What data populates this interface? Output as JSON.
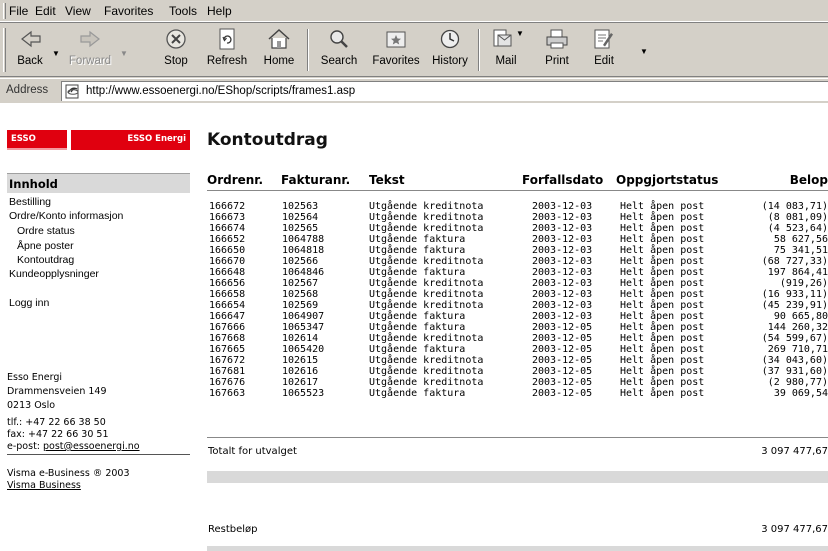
{
  "menu": [
    "File",
    "Edit",
    "View",
    "Favorites",
    "Tools",
    "Help"
  ],
  "toolbar": {
    "back": "Back",
    "forward": "Forward",
    "stop": "Stop",
    "refresh": "Refresh",
    "home": "Home",
    "search": "Search",
    "favorites": "Favorites",
    "history": "History",
    "mail": "Mail",
    "print": "Print",
    "edit": "Edit"
  },
  "address": {
    "label": "Address",
    "url": "http://www.essoenergi.no/EShop/scripts/frames1.asp"
  },
  "logo": {
    "left": "ESSO",
    "right": "ESSO Energi"
  },
  "page_title": "Kontoutdrag",
  "sidebar": {
    "heading": "Innhold",
    "items": [
      {
        "label": "Bestilling"
      },
      {
        "label": "Ordre/Konto informasjon"
      },
      {
        "label": "Ordre status"
      },
      {
        "label": "Åpne poster"
      },
      {
        "label": "Kontoutdrag"
      },
      {
        "label": "Kundeopplysninger"
      },
      {
        "label": "Logg inn"
      }
    ],
    "contact": {
      "company": "Esso Energi",
      "street": "Drammensveien 149",
      "city": "0213 Oslo",
      "phone": "tlf.: +47 22 66 38 50",
      "fax": "fax: +47 22 66 30 51",
      "email_prefix": "e-post: ",
      "email": "post@essoenergi.no"
    },
    "footer": {
      "copyright": "Visma e-Business ® 2003",
      "link": "Visma Business"
    }
  },
  "table": {
    "headers": {
      "ordrenr": "Ordrenr.",
      "fakturanr": "Fakturanr.",
      "tekst": "Tekst",
      "forfallsdato": "Forfallsdato",
      "oppgjortstatus": "Oppgjortstatus",
      "belop": "Belop"
    },
    "rows": [
      {
        "ordrenr": "166672",
        "fakturanr": "102563",
        "tekst": "Utgående kreditnota",
        "forfallsdato": "2003-12-03",
        "status": "Helt åpen post",
        "belop": "(14 083,71)"
      },
      {
        "ordrenr": "166673",
        "fakturanr": "102564",
        "tekst": "Utgående kreditnota",
        "forfallsdato": "2003-12-03",
        "status": "Helt åpen post",
        "belop": "(8 081,09)"
      },
      {
        "ordrenr": "166674",
        "fakturanr": "102565",
        "tekst": "Utgående kreditnota",
        "forfallsdato": "2003-12-03",
        "status": "Helt åpen post",
        "belop": "(4 523,64)"
      },
      {
        "ordrenr": "166652",
        "fakturanr": "1064788",
        "tekst": "Utgående faktura",
        "forfallsdato": "2003-12-03",
        "status": "Helt åpen post",
        "belop": "58 627,56"
      },
      {
        "ordrenr": "166650",
        "fakturanr": "1064818",
        "tekst": "Utgående faktura",
        "forfallsdato": "2003-12-03",
        "status": "Helt åpen post",
        "belop": "75 341,51"
      },
      {
        "ordrenr": "166670",
        "fakturanr": "102566",
        "tekst": "Utgående kreditnota",
        "forfallsdato": "2003-12-03",
        "status": "Helt åpen post",
        "belop": "(68 727,33)"
      },
      {
        "ordrenr": "166648",
        "fakturanr": "1064846",
        "tekst": "Utgående faktura",
        "forfallsdato": "2003-12-03",
        "status": "Helt åpen post",
        "belop": "197 864,41"
      },
      {
        "ordrenr": "166656",
        "fakturanr": "102567",
        "tekst": "Utgående kreditnota",
        "forfallsdato": "2003-12-03",
        "status": "Helt åpen post",
        "belop": "(919,26)"
      },
      {
        "ordrenr": "166658",
        "fakturanr": "102568",
        "tekst": "Utgående kreditnota",
        "forfallsdato": "2003-12-03",
        "status": "Helt åpen post",
        "belop": "(16 933,11)"
      },
      {
        "ordrenr": "166654",
        "fakturanr": "102569",
        "tekst": "Utgående kreditnota",
        "forfallsdato": "2003-12-03",
        "status": "Helt åpen post",
        "belop": "(45 239,91)"
      },
      {
        "ordrenr": "166647",
        "fakturanr": "1064907",
        "tekst": "Utgående faktura",
        "forfallsdato": "2003-12-03",
        "status": "Helt åpen post",
        "belop": "90 665,80"
      },
      {
        "ordrenr": "167666",
        "fakturanr": "1065347",
        "tekst": "Utgående faktura",
        "forfallsdato": "2003-12-05",
        "status": "Helt åpen post",
        "belop": "144 260,32"
      },
      {
        "ordrenr": "167668",
        "fakturanr": "102614",
        "tekst": "Utgående kreditnota",
        "forfallsdato": "2003-12-05",
        "status": "Helt åpen post",
        "belop": "(54 599,67)"
      },
      {
        "ordrenr": "167665",
        "fakturanr": "1065420",
        "tekst": "Utgående faktura",
        "forfallsdato": "2003-12-05",
        "status": "Helt åpen post",
        "belop": "269 710,71"
      },
      {
        "ordrenr": "167672",
        "fakturanr": "102615",
        "tekst": "Utgående kreditnota",
        "forfallsdato": "2003-12-05",
        "status": "Helt åpen post",
        "belop": "(34 043,60)"
      },
      {
        "ordrenr": "167681",
        "fakturanr": "102616",
        "tekst": "Utgående kreditnota",
        "forfallsdato": "2003-12-05",
        "status": "Helt åpen post",
        "belop": "(37 931,60)"
      },
      {
        "ordrenr": "167676",
        "fakturanr": "102617",
        "tekst": "Utgående kreditnota",
        "forfallsdato": "2003-12-05",
        "status": "Helt åpen post",
        "belop": "(2 980,77)"
      },
      {
        "ordrenr": "167663",
        "fakturanr": "1065523",
        "tekst": "Utgående faktura",
        "forfallsdato": "2003-12-05",
        "status": "Helt åpen post",
        "belop": "39 069,54"
      }
    ],
    "total_label": "Totalt for utvalget",
    "total_value": "3 097 477,67",
    "rest_label": "Restbeløp",
    "rest_value": "3 097 477,67"
  },
  "colors": {
    "brand_red": "#e0000f",
    "chrome_grey": "#d4d0c8",
    "panel_grey": "#d9d9d9"
  }
}
